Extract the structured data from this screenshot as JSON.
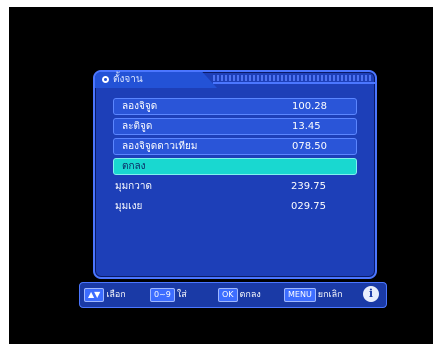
{
  "menu": {
    "title": "ตั้งจาน",
    "rows": [
      {
        "label": "ลองจิจูด",
        "value": "100.28"
      },
      {
        "label": "ละติจูด",
        "value": "13.45"
      },
      {
        "label": "ลองจิจูดดาวเทียม",
        "value": "078.50"
      },
      {
        "label": "ตกลง",
        "value": ""
      },
      {
        "label": "มุมกวาด",
        "value": "239.75"
      },
      {
        "label": "มุมเงย",
        "value": "029.75"
      }
    ]
  },
  "footer": {
    "select": {
      "key": "▲▼",
      "label": "เลือก"
    },
    "input": {
      "key": "0~9",
      "label": "ใส่"
    },
    "ok": {
      "key": "OK",
      "label": "ตกลง"
    },
    "menu": {
      "key": "MENU",
      "label": "ยกเลิก"
    },
    "info": {
      "glyph": "i"
    }
  }
}
